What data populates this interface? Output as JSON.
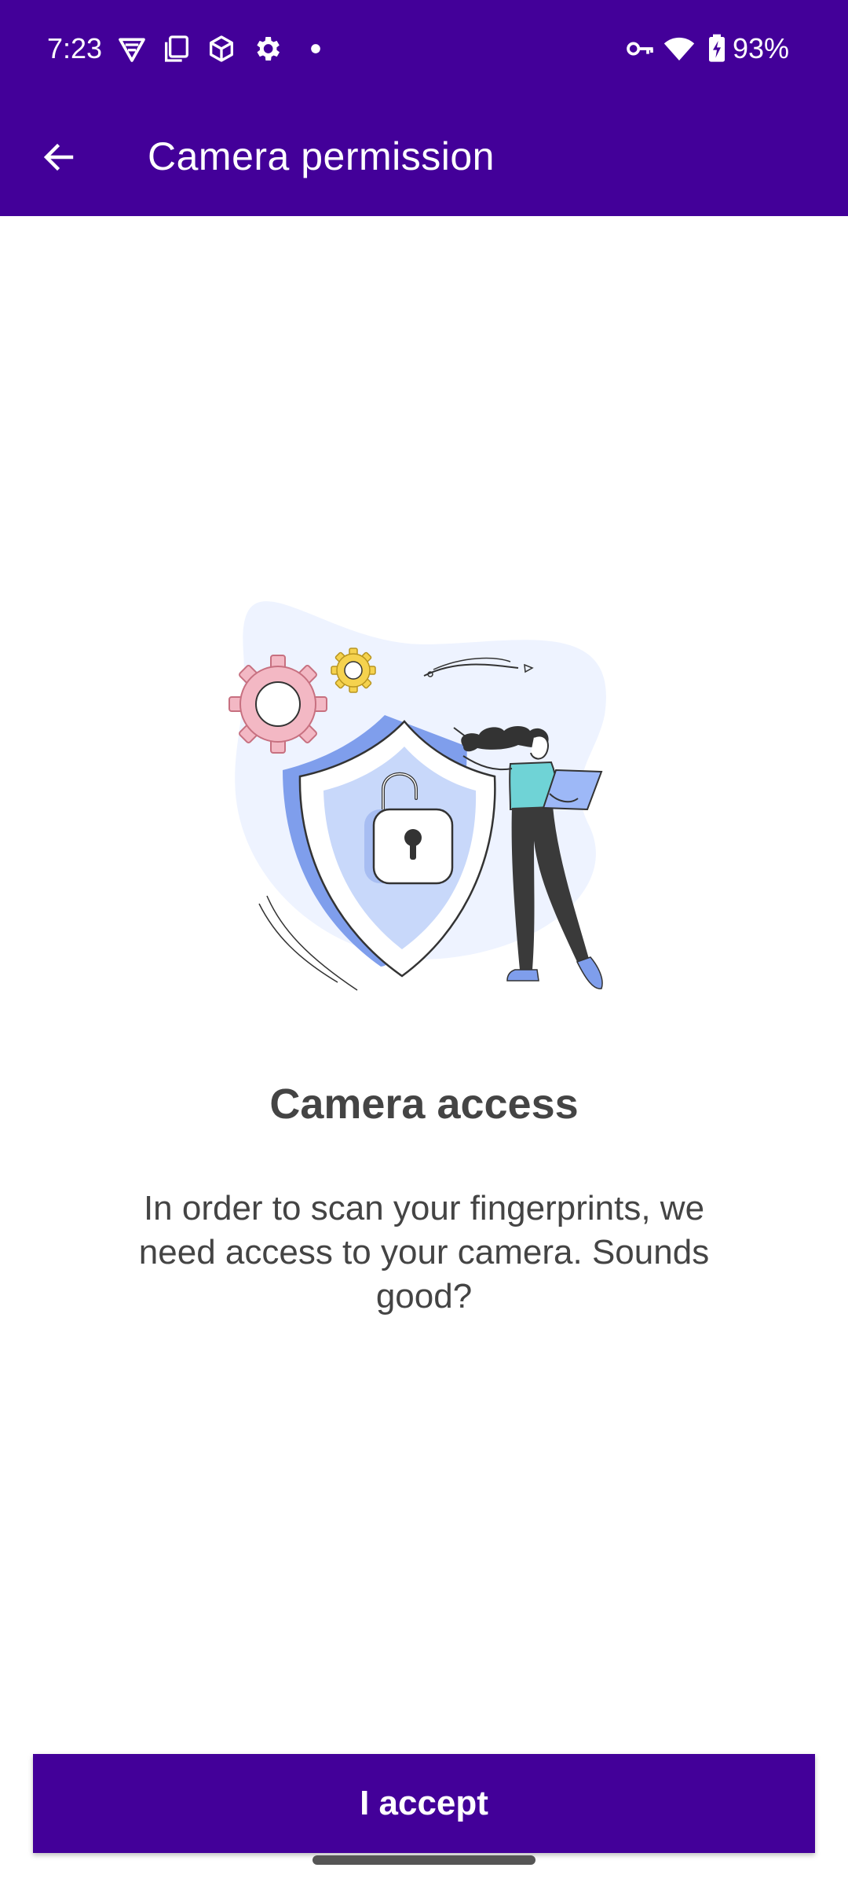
{
  "status_bar": {
    "time": "7:23",
    "battery": "93%",
    "icons": [
      "vpn-shield-icon",
      "screenshot-icon",
      "box-icon",
      "settings-gear-icon",
      "dot-icon",
      "key-icon",
      "wifi-icon",
      "battery-charging-icon"
    ]
  },
  "app_bar": {
    "title": "Camera permission",
    "back_icon": "arrow-left-icon"
  },
  "content": {
    "heading": "Camera access",
    "body": "In order to scan your fingerprints, we need access to your camera. Sounds good?"
  },
  "footer": {
    "accept_label": "I accept"
  },
  "colors": {
    "primary": "#430099",
    "text": "#444444",
    "illustration_bg": "#EEF3FF",
    "shield_blue": "#B9CBF6",
    "accent_pink": "#F3B8C4",
    "accent_yellow": "#F5D24E",
    "accent_teal": "#6FD3D6"
  }
}
